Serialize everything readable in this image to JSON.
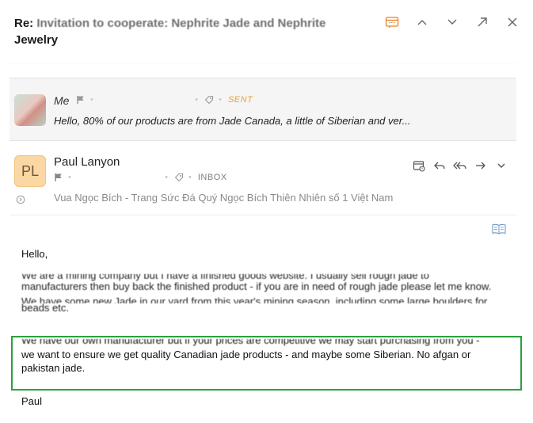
{
  "header": {
    "subject_visible": "Re: ",
    "subject_obscured": "Invitation to cooperate: Nephrite Jade and Nephrite",
    "subject_line2": "Jewelry"
  },
  "thread_item": {
    "name": "Me",
    "status": "SENT",
    "snippet": "Hello, 80% of our products are from Jade Canada, a little of Siberian and ver..."
  },
  "message": {
    "avatar_initials": "PL",
    "avatar_color": "#fbd7a3",
    "sender": "Paul Lanyon",
    "folder": "INBOX",
    "org_line": "Vua Ngọc Bích - Trang Sức Đá Quý Ngọc Bích Thiên Nhiên số 1 Việt Nam"
  },
  "body": {
    "greeting": "Hello,",
    "para1_lines": [
      "We are a mining company but I have a finished goods website. I usually sell rough jade to",
      "manufacturers then buy back the finished product - if you are in need of rough jade please let me know.",
      "We have some new Jade in our yard from this year's mining season, including some large boulders for",
      "beads etc."
    ],
    "para2_cut_line": "We have our own manufacturer but if your prices are competitive we may start purchasing from you -",
    "para2_lines": [
      "we want to ensure we get quality Canadian jade products - and maybe some Siberian.  No afgan or",
      "pakistan jade."
    ],
    "signoff": "Paul"
  },
  "colors": {
    "highlight_border": "#2aa13f",
    "sent_tag": "#e8a23b",
    "accent_orange": "#e8832a"
  },
  "icons": [
    "calendar-icon",
    "chevron-up-icon",
    "chevron-down-icon",
    "popout-icon",
    "close-icon",
    "flag-icon",
    "tag-icon",
    "reply-icon",
    "reply-all-icon",
    "forward-icon",
    "more-chevron-icon",
    "reader-mode-icon",
    "expand-icon"
  ]
}
